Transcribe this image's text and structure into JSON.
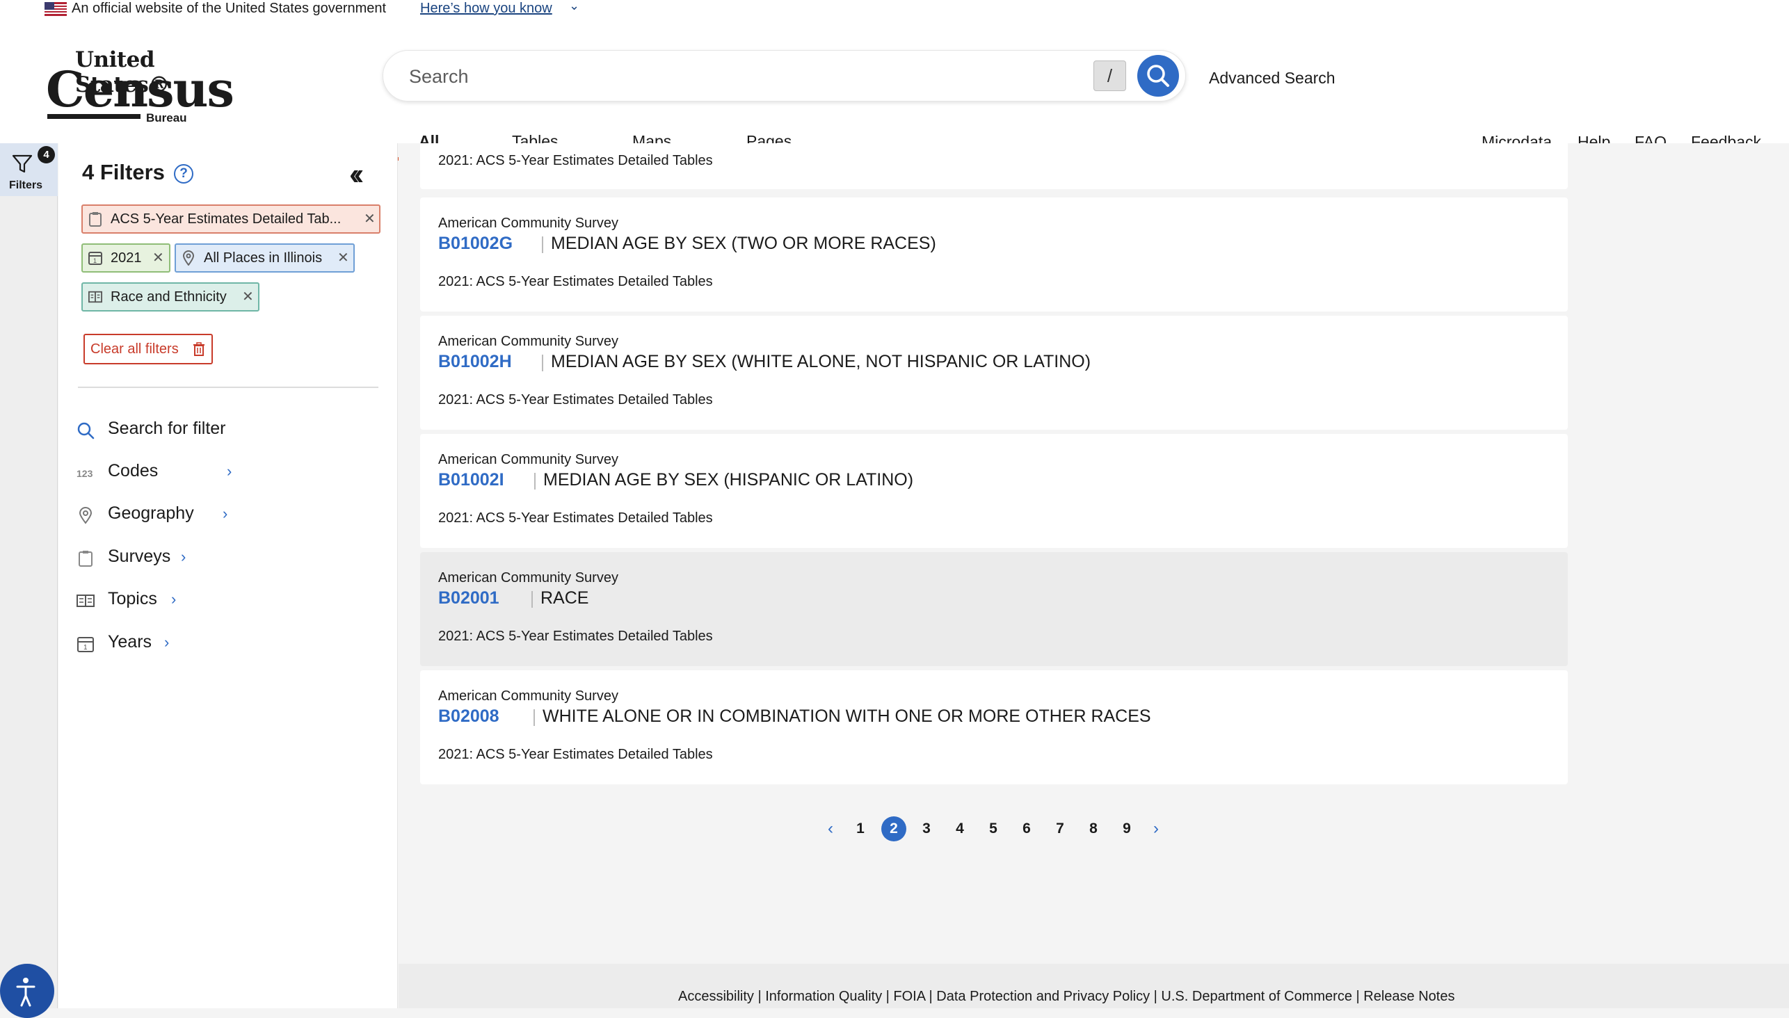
{
  "gov_banner": {
    "text": "An official website of the United States government",
    "link": "Here’s how you know"
  },
  "logo": {
    "line1": "United States®",
    "line2": "Census",
    "line3": "Bureau"
  },
  "search": {
    "placeholder": "Search",
    "shortcut": "/",
    "advanced": "Advanced Search"
  },
  "tabs": [
    "All",
    "Tables",
    "Maps",
    "Pages"
  ],
  "active_tab": "All",
  "top_links": [
    "Microdata",
    "Help",
    "FAQ",
    "Feedback"
  ],
  "rail": {
    "label": "Filters",
    "badge": "4"
  },
  "filters": {
    "title": "4 Filters",
    "chips": [
      {
        "label": "ACS 5-Year Estimates Detailed Tab...",
        "kind": "survey"
      },
      {
        "label": "2021",
        "kind": "year"
      },
      {
        "label": "All Places in Illinois",
        "kind": "geography"
      },
      {
        "label": "Race and Ethnicity",
        "kind": "topic"
      }
    ],
    "clear_label": "Clear all filters",
    "search_label": "Search for filter",
    "items": [
      {
        "label": "Codes",
        "icon": "codes-icon"
      },
      {
        "label": "Geography",
        "icon": "map-pin-icon"
      },
      {
        "label": "Surveys",
        "icon": "clipboard-icon"
      },
      {
        "label": "Topics",
        "icon": "book-icon"
      },
      {
        "label": "Years",
        "icon": "calendar-icon"
      }
    ]
  },
  "results": {
    "partial_meta": "2021: ACS 5-Year Estimates Detailed Tables",
    "cards": [
      {
        "source": "American Community Survey",
        "code": "B01002G",
        "title": "MEDIAN AGE BY SEX (TWO OR MORE RACES)",
        "meta": "2021: ACS 5-Year Estimates Detailed Tables"
      },
      {
        "source": "American Community Survey",
        "code": "B01002H",
        "title": "MEDIAN AGE BY SEX (WHITE ALONE, NOT HISPANIC OR LATINO)",
        "meta": "2021: ACS 5-Year Estimates Detailed Tables"
      },
      {
        "source": "American Community Survey",
        "code": "B01002I",
        "title": "MEDIAN AGE BY SEX (HISPANIC OR LATINO)",
        "meta": "2021: ACS 5-Year Estimates Detailed Tables"
      },
      {
        "source": "American Community Survey",
        "code": "B02001",
        "title": "RACE",
        "meta": "2021: ACS 5-Year Estimates Detailed Tables"
      },
      {
        "source": "American Community Survey",
        "code": "B02008",
        "title": "WHITE ALONE OR IN COMBINATION WITH ONE OR MORE OTHER RACES",
        "meta": "2021: ACS 5-Year Estimates Detailed Tables"
      }
    ]
  },
  "pagination": {
    "pages": [
      "1",
      "2",
      "3",
      "4",
      "5",
      "6",
      "7",
      "8",
      "9"
    ],
    "current": "2"
  },
  "footer": {
    "links": [
      "Accessibility",
      "Information Quality",
      "FOIA",
      "Data Protection and Privacy Policy",
      "U.S. Department of Commerce",
      "Release Notes"
    ]
  },
  "colors": {
    "accent": "#2f6bc5",
    "tab_underline": "#d9542c",
    "danger": "#c83b2a"
  }
}
